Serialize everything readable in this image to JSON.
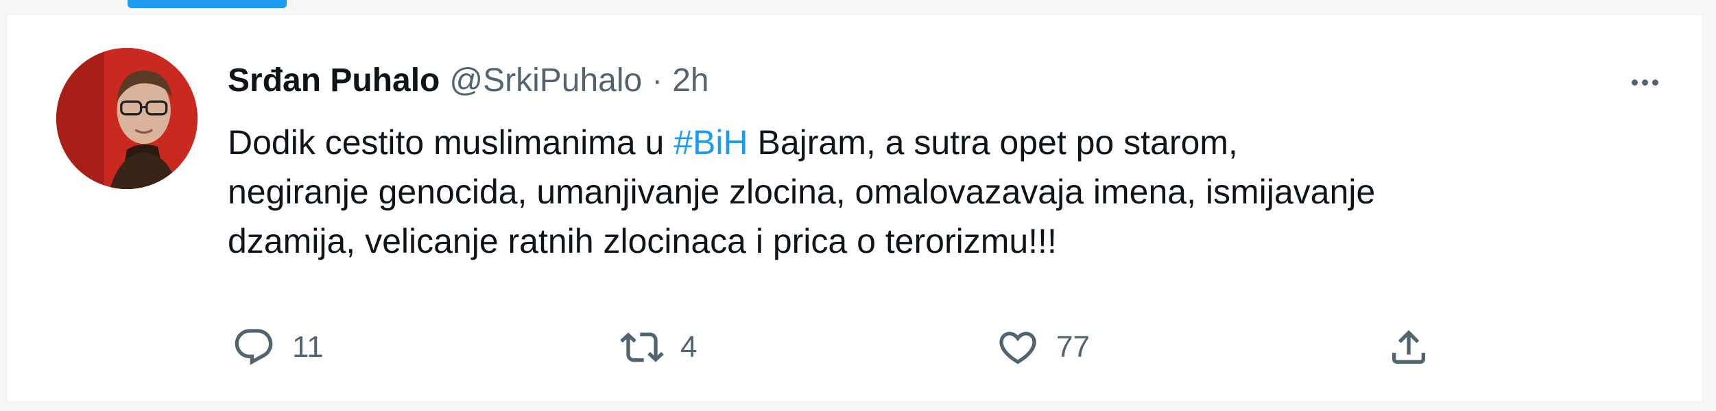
{
  "tweet": {
    "author": {
      "display_name": "Srđan Puhalo",
      "handle": "@SrkiPuhalo",
      "separator": "·",
      "timestamp": "2h"
    },
    "text": {
      "line1_before": "Dodik cestito muslimanima u ",
      "hashtag": "#BiH",
      "line1_after": " Bajram, a sutra opet po starom,",
      "line2": "negiranje genocida, umanjivanje zlocina, omalovazavaja imena, ismijavanje",
      "line3": "dzamija, velicanje ratnih zlocinaca i prica o terorizmu!!!"
    },
    "actions": {
      "reply": {
        "icon": "reply-icon",
        "count": "11"
      },
      "retweet": {
        "icon": "retweet-icon",
        "count": "4"
      },
      "like": {
        "icon": "heart-icon",
        "count": "77"
      },
      "share": {
        "icon": "share-icon"
      }
    },
    "more_icon": "more-horizontal-icon"
  },
  "colors": {
    "accent": "#1d9bf0",
    "text_primary": "#0f1419",
    "text_secondary": "#536471",
    "avatar_background": "#c9291f"
  }
}
